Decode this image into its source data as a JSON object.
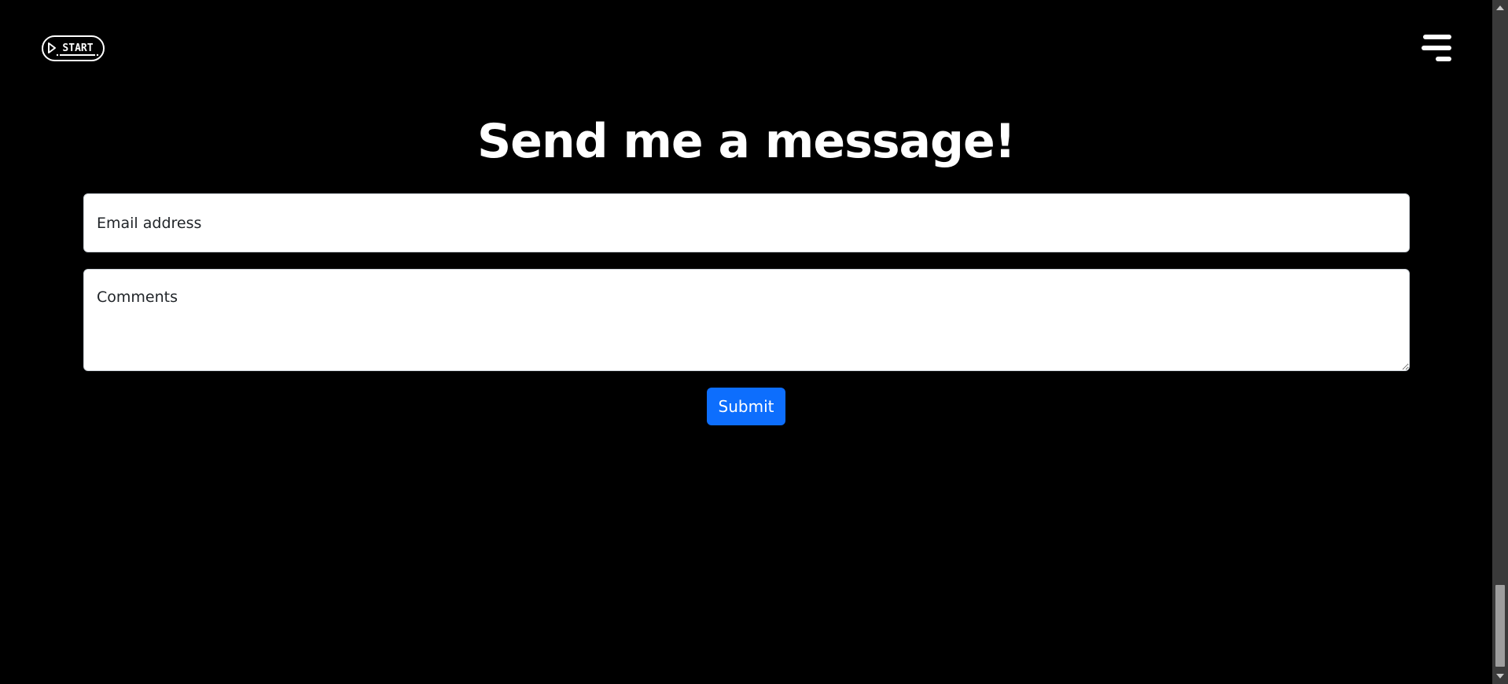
{
  "header": {
    "logo_text": "START",
    "menu_icon": "hamburger-menu-icon"
  },
  "main": {
    "title": "Send me a message!",
    "email_placeholder": "Email address",
    "comments_placeholder": "Comments",
    "submit_label": "Submit"
  },
  "colors": {
    "background": "#000000",
    "text": "#ffffff",
    "accent": "#0d6efd"
  }
}
